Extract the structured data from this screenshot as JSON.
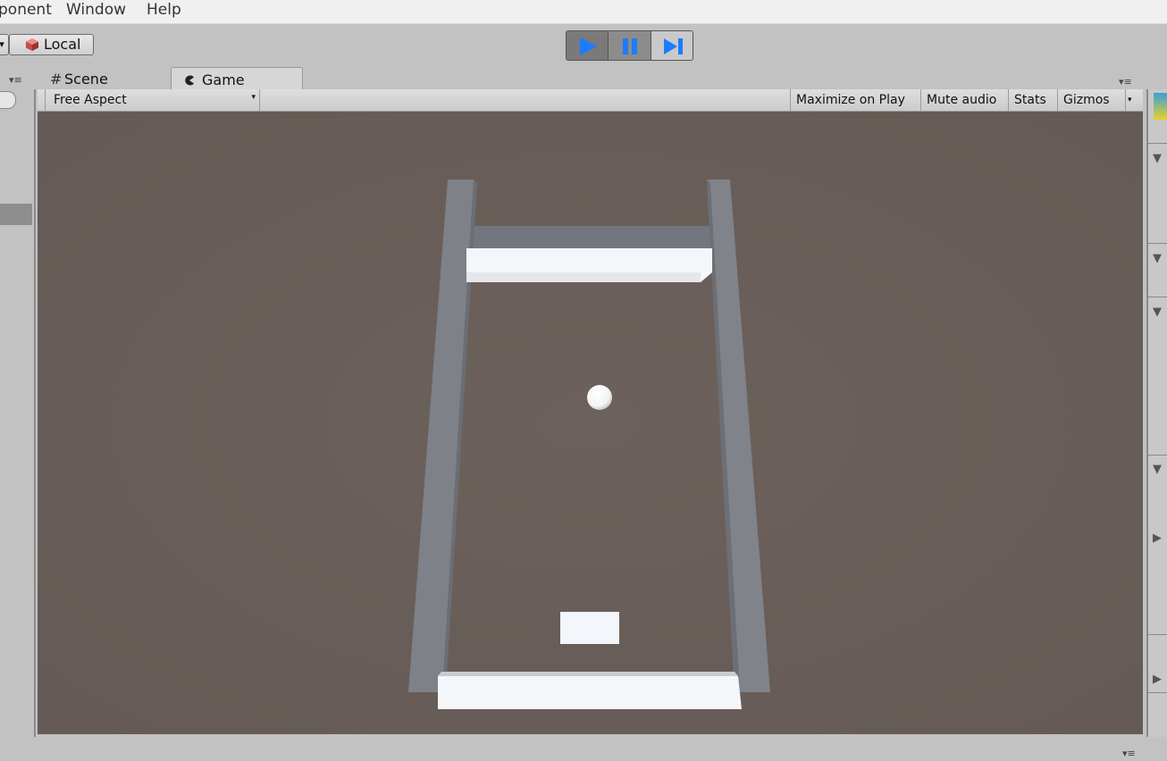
{
  "menu": [
    "ponent",
    "Window",
    "Help"
  ],
  "toolbar": {
    "pivot_caret": "▾",
    "local_label": "Local",
    "play_controls": [
      "play-icon",
      "pause-icon",
      "step-icon"
    ],
    "accent_color": "#1b7cff"
  },
  "tabs": {
    "scene_label": "Scene",
    "game_label": "Game",
    "panel_menu_glyph": "▾≡"
  },
  "game_toolbar": {
    "aspect_label": "Free Aspect",
    "maximize_label": "Maximize on Play",
    "mute_label": "Mute audio",
    "stats_label": "Stats",
    "gizmos_label": "Gizmos"
  },
  "scene": {
    "background_color": "#6a5f5a",
    "wall_color": "#7c7f85",
    "brick_color": "#f2f5fa",
    "objects": [
      "left-wall",
      "right-wall",
      "back-wall",
      "top-brick",
      "ball",
      "paddle",
      "bottom-brick"
    ]
  },
  "status": {
    "menu_glyph": "▾≡"
  }
}
